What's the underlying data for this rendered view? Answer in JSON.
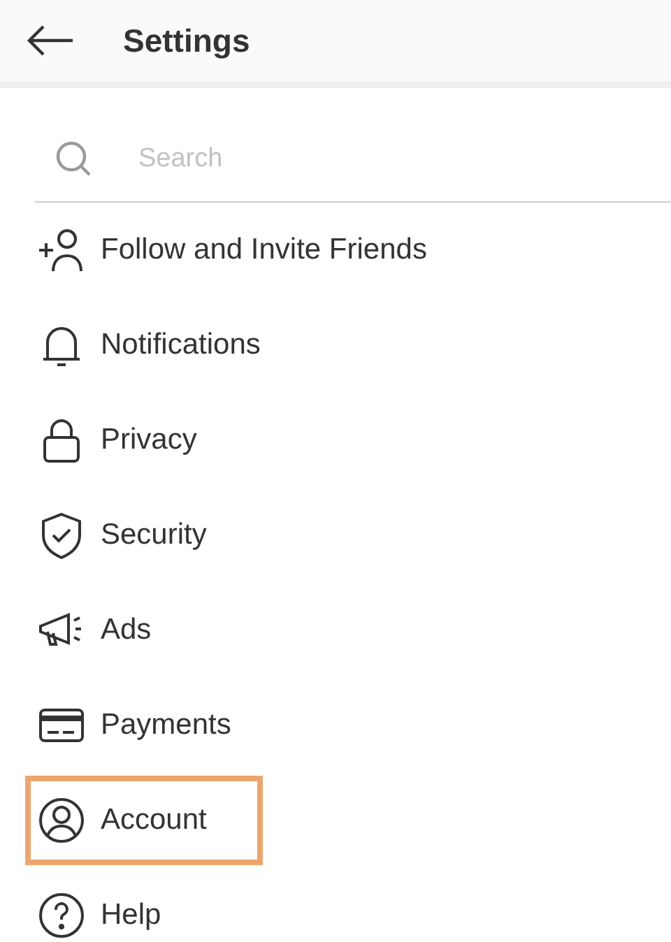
{
  "header": {
    "title": "Settings"
  },
  "search": {
    "placeholder": "Search"
  },
  "items": [
    {
      "kind": "follow",
      "label": "Follow and Invite Friends",
      "highlighted": false
    },
    {
      "kind": "bell",
      "label": "Notifications",
      "highlighted": false
    },
    {
      "kind": "lock",
      "label": "Privacy",
      "highlighted": false
    },
    {
      "kind": "shield",
      "label": "Security",
      "highlighted": false
    },
    {
      "kind": "megaphone",
      "label": "Ads",
      "highlighted": false
    },
    {
      "kind": "card",
      "label": "Payments",
      "highlighted": false
    },
    {
      "kind": "person",
      "label": "Account",
      "highlighted": true
    },
    {
      "kind": "help",
      "label": "Help",
      "highlighted": false
    }
  ]
}
